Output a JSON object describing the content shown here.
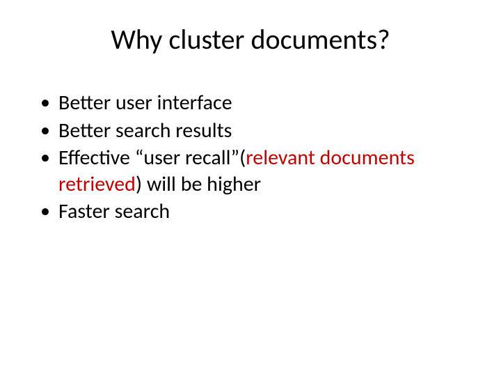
{
  "title": "Why cluster documents?",
  "bullets": [
    {
      "text": "Better user interface"
    },
    {
      "text": "Better search results"
    },
    {
      "segments": {
        "pre": "Effective “user recall”(",
        "highlight": "relevant documents retrieved",
        "post": ") will be higher"
      }
    },
    {
      "text": "Faster search"
    }
  ]
}
